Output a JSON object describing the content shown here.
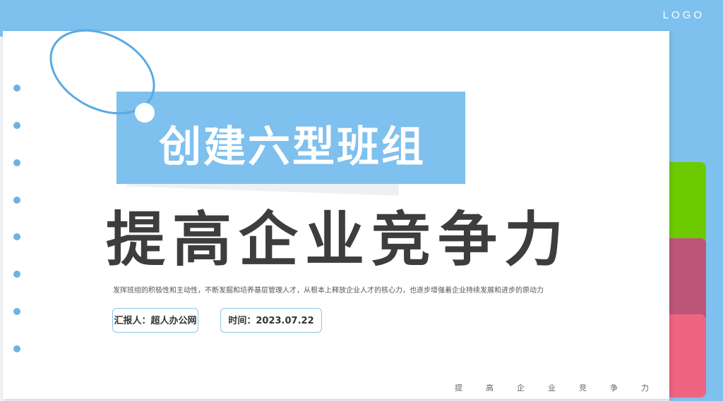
{
  "header": {
    "logo": "LOGO"
  },
  "slide": {
    "title": "创建六型班组",
    "headline": "提高企业竞争力",
    "description": "发挥班组的积极性和主动性，不断发掘和培养基层管理人才，从根本上释放企业人才的核心力，也逐步增强着企业持续发展和进步的原动力",
    "reporter": "汇报人：超人办公网",
    "date": "时间：2023.07.22",
    "footer": "提高企业竞争力"
  },
  "colors": {
    "accent_blue": "#7ec0ee",
    "tab_green": "#6ccb00",
    "tab_plum": "#bd5579",
    "tab_pink": "#ef6482",
    "headline": "#3d3d3d"
  }
}
